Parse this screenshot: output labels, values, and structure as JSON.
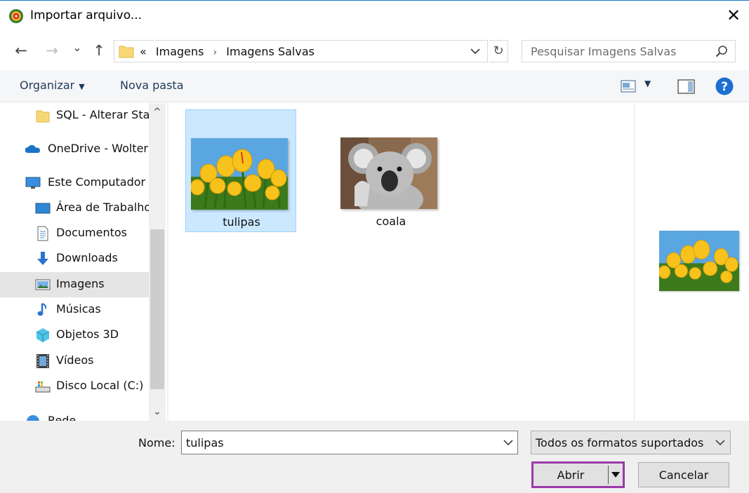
{
  "window": {
    "title": "Importar arquivo...",
    "close_glyph": "✕"
  },
  "navigation": {
    "back_glyph": "←",
    "forward_glyph": "→",
    "recent_glyph": "⌄",
    "up_glyph": "↑",
    "breadcrumb_overflow": "«",
    "breadcrumbs": [
      "Imagens",
      "Imagens Salvas"
    ],
    "breadcrumb_separator": "›",
    "refresh_glyph": "↻",
    "search_placeholder": "Pesquisar Imagens Salvas"
  },
  "toolbar": {
    "organize_label": "Organizar",
    "organize_caret": "▼",
    "new_folder_label": "Nova pasta",
    "view_caret": "▼",
    "help_glyph": "?"
  },
  "sidebar": {
    "items": [
      {
        "label": "SQL - Alterar Sta",
        "icon": "folder-icon"
      },
      {
        "label": "OneDrive - Wolter",
        "icon": "onedrive-cloud-icon"
      },
      {
        "label": "Este Computador",
        "icon": "computer-icon"
      },
      {
        "label": "Área de Trabalho",
        "icon": "desktop-icon"
      },
      {
        "label": "Documentos",
        "icon": "documents-icon"
      },
      {
        "label": "Downloads",
        "icon": "downloads-icon"
      },
      {
        "label": "Imagens",
        "icon": "pictures-icon",
        "selected": true
      },
      {
        "label": "Músicas",
        "icon": "music-icon"
      },
      {
        "label": "Objetos 3D",
        "icon": "3d-objects-icon"
      },
      {
        "label": "Vídeos",
        "icon": "videos-icon"
      },
      {
        "label": "Disco Local (C:)",
        "icon": "local-disk-icon"
      },
      {
        "label": "Rede",
        "icon": "network-icon"
      }
    ],
    "scroll_up_glyph": "^",
    "scroll_down_glyph": "⌄"
  },
  "files": [
    {
      "name": "tulipas",
      "thumbnail": "tulips-image",
      "selected": true
    },
    {
      "name": "coala",
      "thumbnail": "koala-image",
      "selected": false
    }
  ],
  "footer": {
    "name_label": "Nome:",
    "name_value": "tulipas",
    "file_type_filter": "Todos os formatos suportados",
    "open_button": "Abrir",
    "cancel_button": "Cancelar"
  },
  "colors": {
    "selection_fill": "#cce8ff",
    "selection_border": "#99d1ff",
    "open_button_highlight": "#9b3aa8",
    "toolbar_text": "#1e395b",
    "help_blue": "#1c6fd1"
  }
}
